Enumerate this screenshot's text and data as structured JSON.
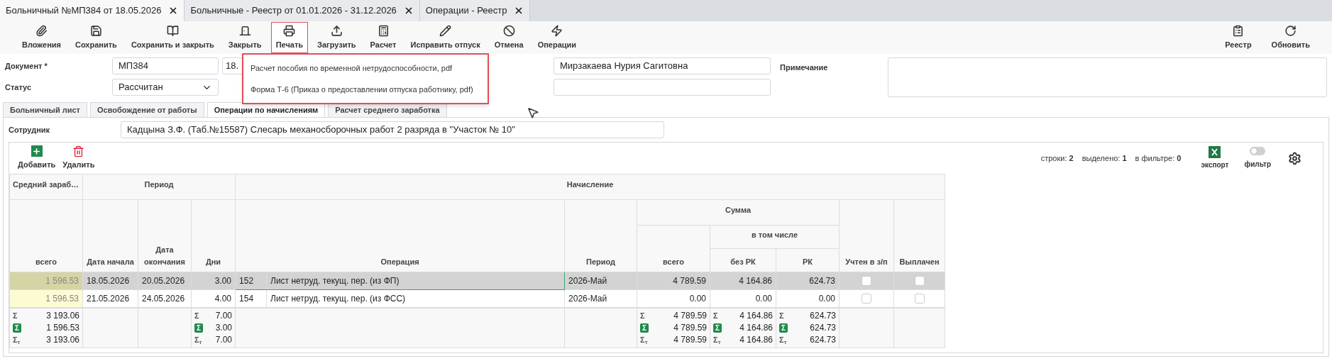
{
  "tabs": [
    {
      "label": "Больничный №МП384 от 18.05.2026",
      "selected": true
    },
    {
      "label": "Больничные - Реестр от 01.01.2026 - 31.12.2026",
      "selected": false
    },
    {
      "label": "Операции - Реестр",
      "selected": false
    }
  ],
  "toolbar": {
    "left": [
      {
        "label": "Вложения",
        "open": false
      },
      {
        "label": "Сохранить",
        "open": false
      },
      {
        "label": "Сохранить и закрыть",
        "open": false
      },
      {
        "label": "Закрыть",
        "open": false
      },
      {
        "label": "Печать",
        "open": true
      },
      {
        "label": "Загрузить",
        "open": false
      },
      {
        "label": "Расчет",
        "open": false
      },
      {
        "label": "Исправить отпуск",
        "open": false
      },
      {
        "label": "Отмена",
        "open": false
      },
      {
        "label": "Операции",
        "open": false
      }
    ],
    "right": [
      {
        "label": "Реестр"
      },
      {
        "label": "Обновить"
      }
    ]
  },
  "print_menu": [
    "Расчет пособия по временной нетрудоспособности, pdf",
    "Форма Т-6 (Приказ о предоставлении отпуска работнику, pdf)"
  ],
  "form": {
    "document_label": "Документ *",
    "document_number": "МП384",
    "document_date": "18.",
    "status_label": "Статус",
    "status": "Рассчитан",
    "employee_name": "Мирзакаева Нурия Сагитовна",
    "note_label": "Примечание"
  },
  "inner_tabs": [
    {
      "label": "Больничный лист",
      "selected": false
    },
    {
      "label": "Освобождение от работы",
      "selected": false
    },
    {
      "label": "Операции по начислениям",
      "selected": true
    },
    {
      "label": "Расчет среднего заработка",
      "selected": false
    }
  ],
  "employee": {
    "label": "Сотрудник",
    "value": "Кадцына З.Ф. (Таб.№15587) Слесарь механосборочных работ 2 разряда в \"Участок № 10\""
  },
  "grid": {
    "add": "Добавить",
    "delete": "Удалить",
    "stats": [
      {
        "label": "строки:",
        "value": "2"
      },
      {
        "label": "выделено:",
        "value": "1"
      },
      {
        "label": "в фильтре:",
        "value": "0"
      }
    ],
    "export": "экспорт",
    "filter": {
      "label": "фильтр",
      "on": false
    }
  },
  "table": {
    "headers": {
      "avg": "Средний зараб…",
      "period": "Период",
      "accrual": "Начисление",
      "sum": "Сумма",
      "including": "в том числе",
      "avg_total": "всего",
      "start": "Дата начала",
      "end": "Дата окончания",
      "days": "Дни",
      "operation": "Операция",
      "accrual_period": "Период",
      "total": "всего",
      "no_rk": "без РК",
      "rk": "РК",
      "accounted": "Учтен в з/п",
      "paid": "Выплачен"
    },
    "rows": [
      {
        "selected": true,
        "avg": "1 596.53",
        "start": "18.05.2026",
        "end": "20.05.2026",
        "days": "3.00",
        "code": "152",
        "operation": "Лист нетруд. текущ. пер. (из ФП)",
        "period": "2026-Май",
        "total": "4 789.59",
        "no_rk": "4 164.86",
        "rk": "624.73",
        "accounted": false,
        "paid": false
      },
      {
        "selected": false,
        "avg": "1 596.53",
        "start": "21.05.2026",
        "end": "24.05.2026",
        "days": "4.00",
        "code": "154",
        "operation": "Лист нетруд. текущ. пер. (из ФСС)",
        "period": "2026-Май",
        "total": "0.00",
        "no_rk": "0.00",
        "rk": "0.00",
        "accounted": false,
        "paid": false
      }
    ],
    "totals": {
      "avg": [
        {
          "kind": "all",
          "symbol": "Σ",
          "value": "3 193.06"
        },
        {
          "kind": "selected",
          "symbol": "Σ",
          "value": "1 596.53"
        },
        {
          "kind": "filtered",
          "symbol": "Σ",
          "sub": "т",
          "value": "3 193.06"
        }
      ],
      "days": [
        {
          "kind": "all",
          "symbol": "Σ",
          "value": "7.00"
        },
        {
          "kind": "selected",
          "symbol": "Σ",
          "value": "3.00"
        },
        {
          "kind": "filtered",
          "symbol": "Σ",
          "sub": "т",
          "value": "7.00"
        }
      ],
      "total": [
        {
          "kind": "all",
          "symbol": "Σ",
          "value": "4 789.59"
        },
        {
          "kind": "selected",
          "symbol": "Σ",
          "value": "4 789.59"
        },
        {
          "kind": "filtered",
          "symbol": "Σ",
          "sub": "т",
          "value": "4 789.59"
        }
      ],
      "no_rk": [
        {
          "kind": "all",
          "symbol": "Σ",
          "value": "4 164.86"
        },
        {
          "kind": "selected",
          "symbol": "Σ",
          "value": "4 164.86"
        },
        {
          "kind": "filtered",
          "symbol": "Σ",
          "sub": "т",
          "value": "4 164.86"
        }
      ],
      "rk": [
        {
          "kind": "all",
          "symbol": "Σ",
          "value": "624.73"
        },
        {
          "kind": "selected",
          "symbol": "Σ",
          "value": "624.73"
        },
        {
          "kind": "filtered",
          "symbol": "Σ",
          "sub": "т",
          "value": "624.73"
        }
      ]
    }
  }
}
